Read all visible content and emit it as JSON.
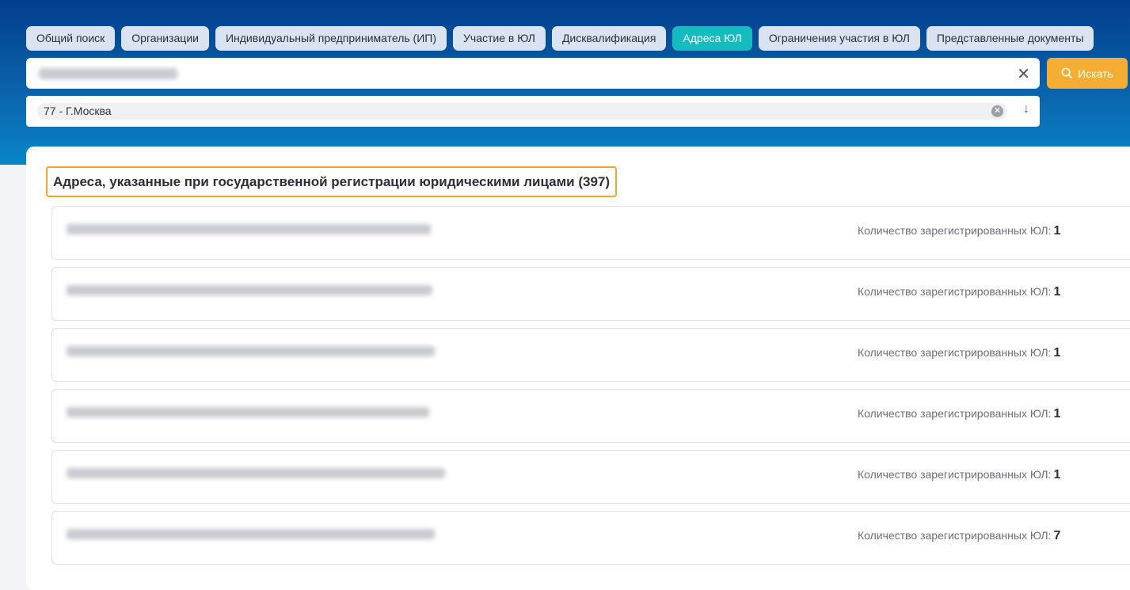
{
  "tabs": [
    {
      "label": "Общий поиск",
      "active": false
    },
    {
      "label": "Организации",
      "active": false
    },
    {
      "label": "Индивидуальный предприниматель (ИП)",
      "active": false
    },
    {
      "label": "Участие в ЮЛ",
      "active": false
    },
    {
      "label": "Дисквалификация",
      "active": false
    },
    {
      "label": "Адреса ЮЛ",
      "active": true
    },
    {
      "label": "Ограничения участия в ЮЛ",
      "active": false
    },
    {
      "label": "Представленные документы",
      "active": false
    }
  ],
  "search": {
    "button_label": "Искать"
  },
  "region": {
    "selected": "77 - Г.Москва"
  },
  "results": {
    "title": "Адреса, указанные при государственной регистрации юридическими лицами (397)",
    "count_label": "Количество зарегистрированных ЮЛ:",
    "rows": [
      {
        "count": "1"
      },
      {
        "count": "1"
      },
      {
        "count": "1"
      },
      {
        "count": "1"
      },
      {
        "count": "1"
      },
      {
        "count": "7"
      }
    ]
  }
}
